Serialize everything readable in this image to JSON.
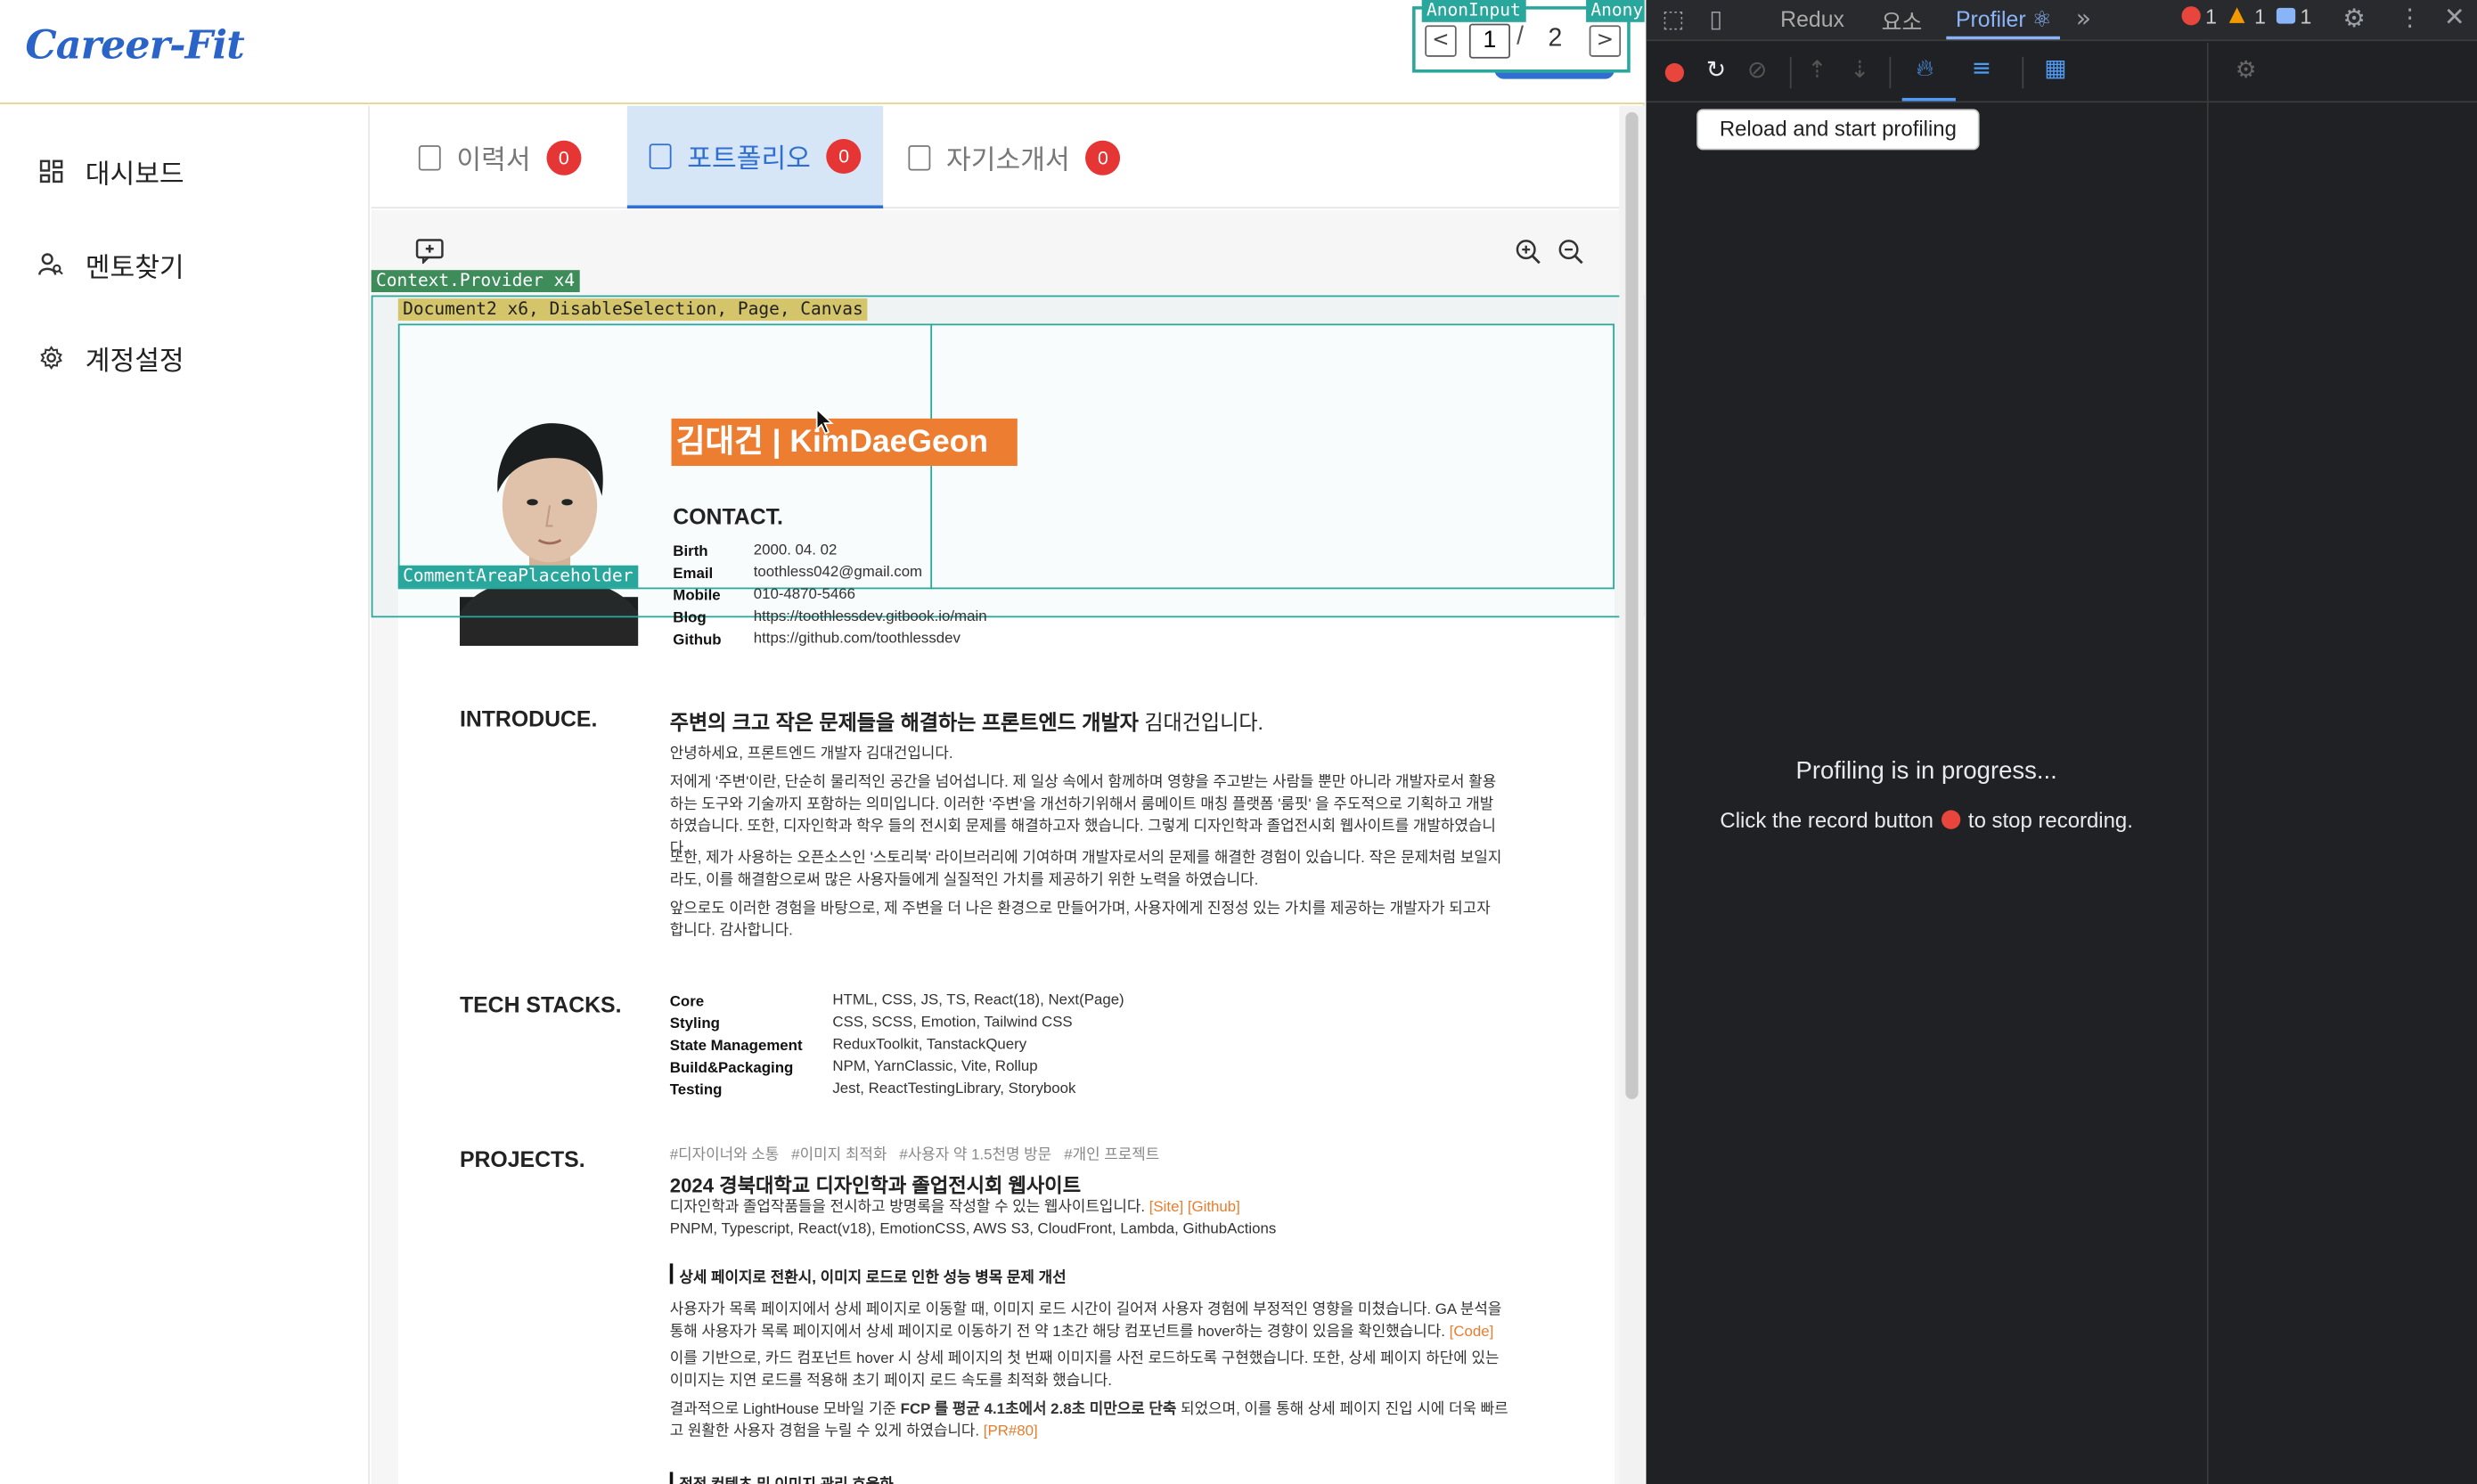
{
  "app": {
    "logo": "Career-Fit",
    "pager": {
      "current": "1",
      "separator": "/",
      "total": "2",
      "prev": "<",
      "next": ">"
    },
    "sidebar": {
      "items": [
        {
          "label": "대시보드",
          "icon": "dashboard-icon"
        },
        {
          "label": "멘토찾기",
          "icon": "person-search-icon"
        },
        {
          "label": "계정설정",
          "icon": "gear-icon"
        }
      ]
    },
    "tabs": [
      {
        "label": "이력서",
        "count": "0"
      },
      {
        "label": "포트폴리오",
        "count": "0"
      },
      {
        "label": "자기소개서",
        "count": "0"
      }
    ],
    "active_tab": "포트폴리오"
  },
  "react_overlay": {
    "anon_input": "AnonInput",
    "anony": "Anony",
    "context_provider": "Context.Provider x4",
    "document": "Document2 x6, DisableSelection, Page, Canvas",
    "comment_placeholder": "CommentAreaPlaceholder"
  },
  "resume": {
    "name_banner": "김대건 | KimDaeGeon",
    "contact_title": "CONTACT.",
    "contact": [
      {
        "label": "Birth",
        "value": "2000. 04. 02"
      },
      {
        "label": "Email",
        "value": "toothless042@gmail.com"
      },
      {
        "label": "Mobile",
        "value": "010-4870-5466"
      },
      {
        "label": "Blog",
        "value": "https://toothlessdev.gitbook.io/main"
      },
      {
        "label": "Github",
        "value": "https://github.com/toothlessdev"
      }
    ],
    "introduce_title": "INTRODUCE.",
    "introduce_headline_bold": "주변의 크고 작은 문제들을 해결하는 프론트엔드 개발자",
    "introduce_headline_rest": " 김대건입니다.",
    "introduce_paragraphs": [
      "안녕하세요, 프론트엔드 개발자 김대건입니다.",
      "저에게 '주변'이란, 단순히 물리적인 공간을 넘어섭니다. 제 일상 속에서 함께하며 영향을 주고받는 사람들 뿐만 아니라 개발자로서 활용하는 도구와 기술까지 포함하는 의미입니다. 이러한 '주변'을 개선하기위해서 룸메이트 매칭 플랫폼 '룸핏' 을 주도적으로 기획하고 개발하였습니다. 또한, 디자인학과 학우 들의 전시회 문제를 해결하고자 했습니다. 그렇게 디자인학과 졸업전시회 웹사이트를 개발하였습니다.",
      "또한, 제가 사용하는 오픈소스인 '스토리북' 라이브러리에 기여하며 개발자로서의 문제를 해결한 경험이 있습니다. 작은 문제처럼 보일지라도, 이를 해결함으로써 많은 사용자들에게 실질적인 가치를 제공하기 위한 노력을 하였습니다.",
      "앞으로도 이러한 경험을 바탕으로, 제 주변을 더 나은 환경으로 만들어가며, 사용자에게 진정성 있는 가치를 제공하는 개발자가 되고자 합니다. 감사합니다."
    ],
    "tech_title": "TECH STACKS.",
    "tech": [
      {
        "label": "Core",
        "value": "HTML, CSS, JS, TS, React(18), Next(Page)"
      },
      {
        "label": "Styling",
        "value": "CSS, SCSS, Emotion, Tailwind CSS"
      },
      {
        "label": "State Management",
        "value": "ReduxToolkit, TanstackQuery"
      },
      {
        "label": "Build&Packaging",
        "value": "NPM, YarnClassic, Vite, Rollup"
      },
      {
        "label": "Testing",
        "value": "Jest, ReactTestingLibrary, Storybook"
      }
    ],
    "projects_title": "PROJECTS.",
    "project_tags": "#디자이너와 소통   #이미지 최적화   #사용자 약 1.5천명 방문   #개인 프로젝트",
    "project_name": "2024 경북대학교 디자인학과 졸업전시회 웹사이트",
    "project_desc": "디자인학과 졸업작품들을 전시하고 방명록을 작성할 수 있는 웹사이트입니다.",
    "project_site": "[Site]",
    "project_github": "[Github]",
    "project_stack": "PNPM, Typescript, React(v18), EmotionCSS, AWS S3, CloudFront, Lambda, GithubActions",
    "subsection_title": "상세 페이지로 전환시, 이미지 로드로 인한 성능 병목 문제 개선",
    "sub_p1": "사용자가 목록 페이지에서 상세 페이지로 이동할 때, 이미지 로드 시간이 길어져 사용자 경험에 부정적인 영향을 미쳤습니다. GA 분석을 통해 사용자가 목록 페이지에서 상세 페이지로 이동하기 전 약 1초간 해당 컴포넌트를 hover하는 경향이 있음을 확인했습니다.",
    "sub_p1_link": "[Code]",
    "sub_p2": "이를 기반으로, 카드 컴포넌트 hover 시 상세 페이지의 첫 번째 이미지를 사전 로드하도록 구현했습니다. 또한, 상세 페이지 하단에 있는 이미지는 지연 로드를 적용해 초기 페이지 로드 속도를 최적화 했습니다.",
    "sub_p3_a": "결과적으로 LightHouse 모바일 기준 ",
    "sub_p3_b": "FCP 를 평균 4.1초에서 2.8초 미만으로 단축",
    "sub_p3_c": " 되었으며, 이를 통해 상세 페이지 진입 시에 더욱 빠르고 원활한 사용자 경험을 누릴 수 있게 하였습니다.",
    "sub_p3_link": "[PR#80]",
    "next_subsection": "정적 컨텐츠 및 이미지 관리 효율화"
  },
  "devtools": {
    "tabs": [
      "Redux",
      "요소",
      "Profiler ⚛"
    ],
    "errors": "1",
    "warnings": "1",
    "messages": "1",
    "tooltip": "Reload and start profiling",
    "progress_title": "Profiling is in progress...",
    "progress_sub_a": "Click the record button",
    "progress_sub_b": "to stop recording."
  },
  "colors": {
    "accent": "#e87d2d",
    "brand": "#2a64c8",
    "overlay": "#2aa79c",
    "badge": "#e53535",
    "devtools_bg": "#202124"
  }
}
